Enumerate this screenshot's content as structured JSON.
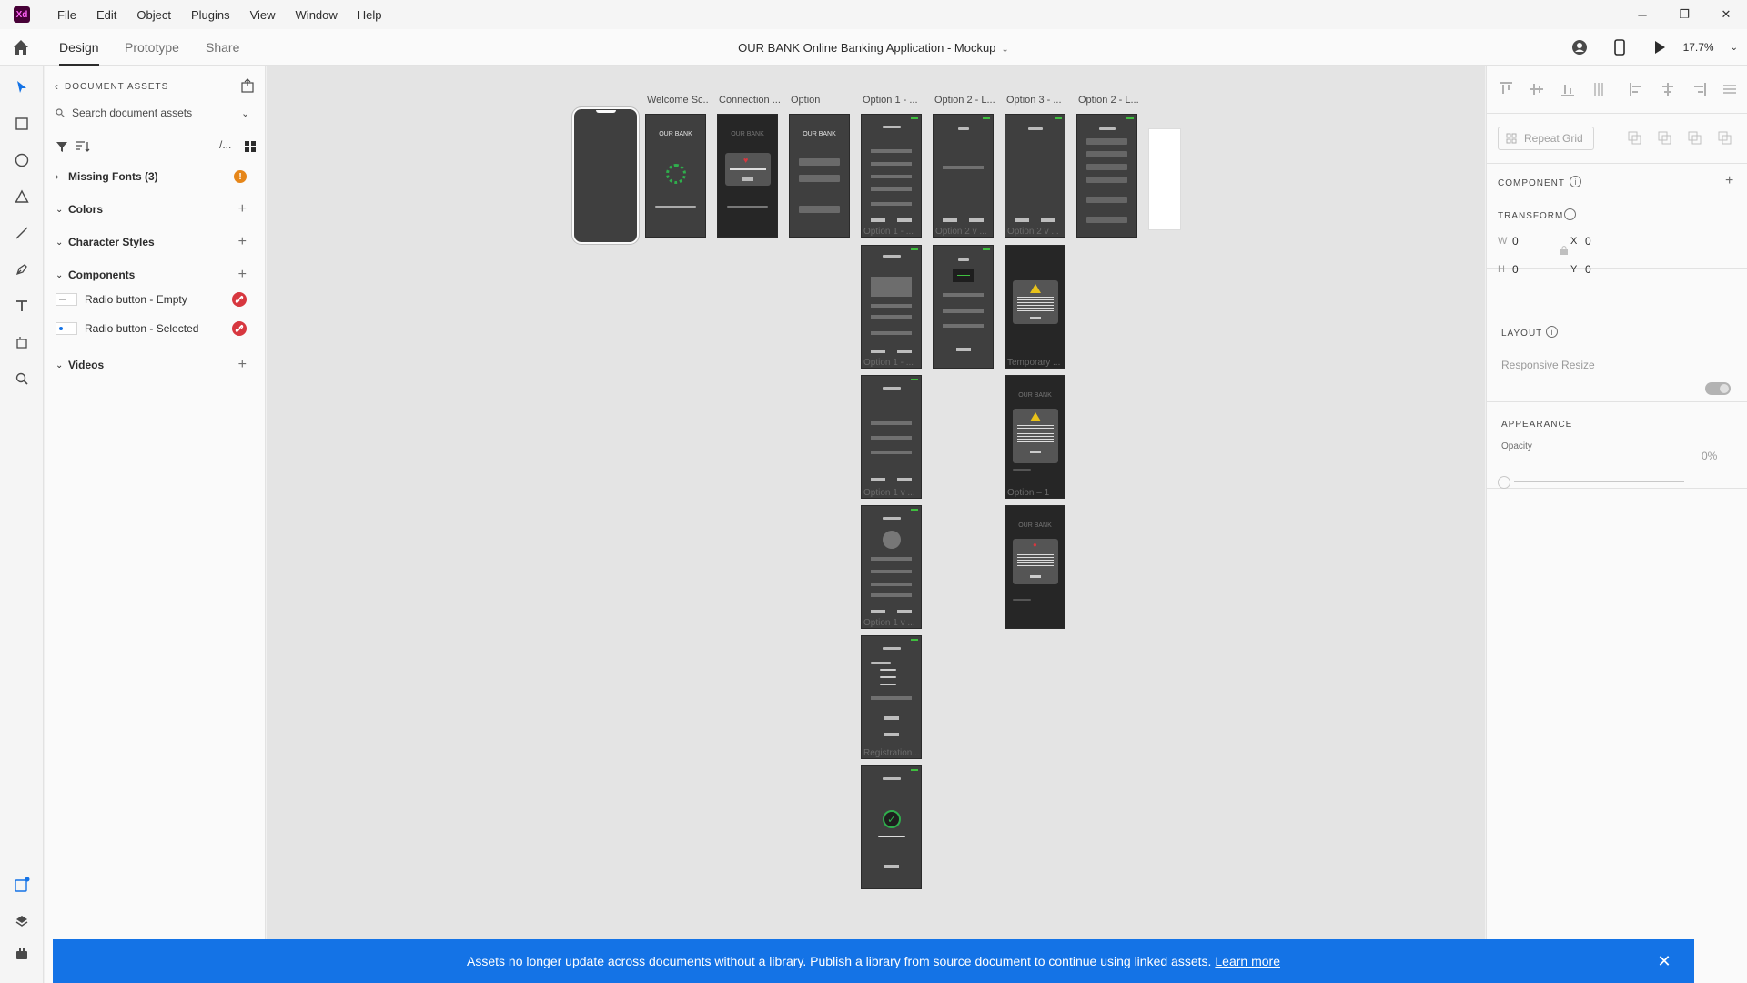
{
  "app": {
    "logo_text": "Xd"
  },
  "menu": {
    "items": [
      "File",
      "Edit",
      "Object",
      "Plugins",
      "View",
      "Window",
      "Help"
    ]
  },
  "window_controls": {
    "minimize": "─",
    "restore": "❐",
    "close": "✕"
  },
  "tabs": {
    "design": "Design",
    "prototype": "Prototype",
    "share": "Share"
  },
  "document": {
    "title": "OUR BANK Online Banking Application - Mockup"
  },
  "toolbar_right": {
    "zoom": "17.7%"
  },
  "assets": {
    "header": "DOCUMENT ASSETS",
    "search_placeholder": "Search document assets",
    "missing_fonts": "Missing Fonts (3)",
    "colors": "Colors",
    "character_styles": "Character Styles",
    "components": "Components",
    "component_items": [
      "Radio button - Empty",
      "Radio button - Selected"
    ],
    "videos": "Videos"
  },
  "canvas": {
    "labels": [
      "Welcome Sc...",
      "Connection ...",
      "Option",
      "Option 1 - ...",
      "Option 2 - L...",
      "Option 3 - ...",
      "Option 2 - L..."
    ],
    "brand": "OUR BANK",
    "captions": [
      "Option 1 - ...",
      "Option 2 v ...",
      "Option 2 v ...",
      "Option 1 - ...",
      "Temporary ...",
      "Option 1 v ...",
      "Option – 1",
      "Option 1 v ...",
      "Registration..."
    ]
  },
  "properties": {
    "repeat_grid": "Repeat Grid",
    "component": "COMPONENT",
    "transform": "TRANSFORM",
    "w_label": "W",
    "w_value": "0",
    "h_label": "H",
    "h_value": "0",
    "x_label": "X",
    "x_value": "0",
    "y_label": "Y",
    "y_value": "0",
    "layout": "LAYOUT",
    "responsive_resize": "Responsive Resize",
    "appearance": "APPEARANCE",
    "opacity_label": "Opacity",
    "opacity_value": "0%"
  },
  "banner": {
    "message": "Assets no longer update across documents without a library. Publish a library from source document to continue using linked assets.",
    "link": "Learn more"
  }
}
